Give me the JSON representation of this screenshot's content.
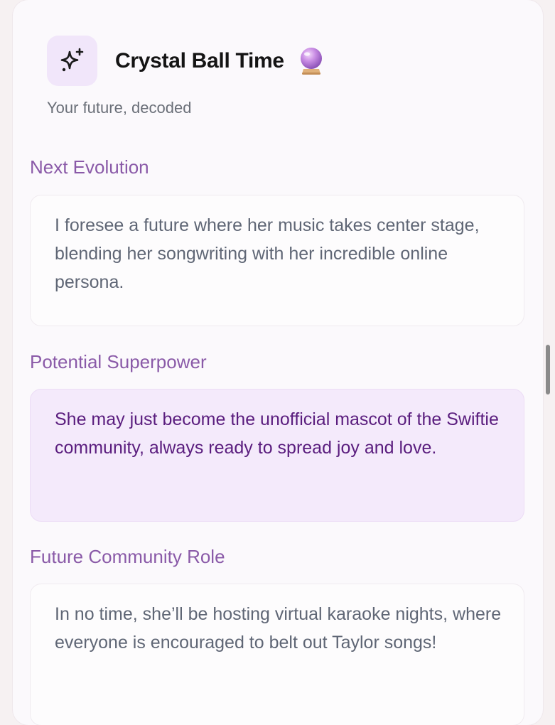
{
  "header": {
    "title": "Crystal Ball Time",
    "subtitle": "Your future, decoded",
    "icon": "sparkles-icon",
    "emoji": "crystal-ball-icon"
  },
  "sections": [
    {
      "label": "Next Evolution",
      "text": "I foresee a future where her music takes center stage, blending her songwriting with her incredible online persona."
    },
    {
      "label": "Potential Superpower",
      "text": "She may just become the unofficial mascot of the Swiftie community, always ready to spread joy and love."
    },
    {
      "label": "Future Community Role",
      "text": "In no time, she’ll be hosting virtual karaoke nights, where everyone is encouraged to belt out Taylor songs!"
    }
  ],
  "colors": {
    "accent": "#8a5aa8",
    "highlight_bg": "#f4eafb",
    "highlight_text": "#5a1d7e",
    "icon_tile_bg": "#f1e6fa"
  }
}
